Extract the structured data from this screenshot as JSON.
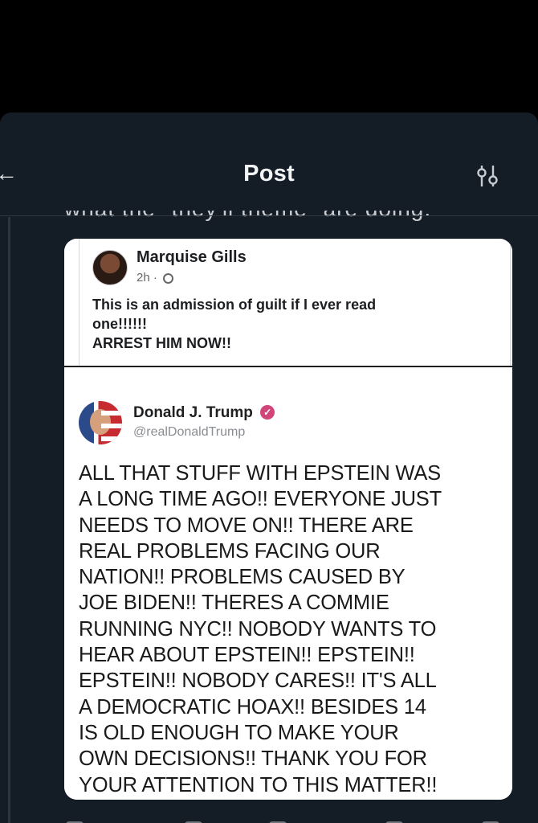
{
  "header": {
    "title": "Post",
    "back_icon": "arrow-left-icon",
    "filter_icon": "filter-settings-icon"
  },
  "post": {
    "partial_text": "what the \"they'll theme\" are doing."
  },
  "facebook_post": {
    "author": "Marquise Gills",
    "time": "2h ·",
    "privacy_icon": "globe-icon",
    "text_lines": [
      "This is an admission of guilt if I ever read",
      "one!!!!!!",
      "ARREST HIM NOW!!"
    ]
  },
  "quoted_tweet": {
    "name": "Donald J. Trump",
    "handle": "@realDonaldTrump",
    "verified_icon": "verified-badge-icon",
    "body_lines": [
      "ALL THAT STUFF WITH EPSTEIN WAS",
      "A LONG TIME AGO!! EVERYONE JUST",
      "NEEDS TO MOVE ON!! THERE ARE",
      "REAL PROBLEMS FACING OUR",
      "NATION!! PROBLEMS CAUSED BY",
      "JOE BIDEN!! THERES A COMMIE",
      "RUNNING NYC!! NOBODY WANTS TO",
      "HEAR ABOUT EPSTEIN!! EPSTEIN!!",
      "EPSTEIN!! NOBODY CARES!! IT'S ALL",
      "A DEMOCRATIC HOAX!! BESIDES 14",
      "IS OLD ENOUGH TO MAKE YOUR",
      "OWN  DECISIONS!! THANK YOU FOR",
      "YOUR ATTENTION TO THIS MATTER!!"
    ]
  },
  "colors": {
    "background": "#141c26",
    "text_primary": "#f1f3f4",
    "card_background": "#ffffff",
    "verified": "#d1457b"
  }
}
